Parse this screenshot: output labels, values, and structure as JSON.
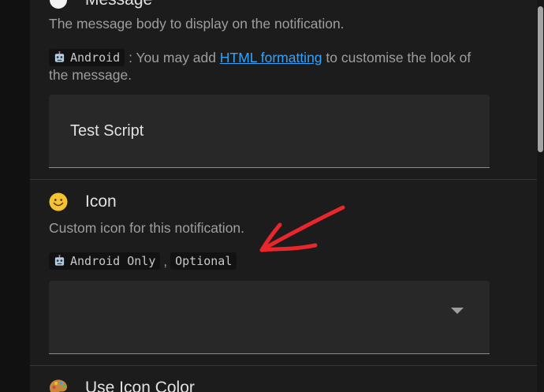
{
  "message_section": {
    "title": "Message",
    "description": "The message body to display on the notification.",
    "platform_tag": "Android",
    "note_before_link": " : You may add ",
    "link_text": "HTML formatting",
    "note_after_link": " to customise the look of the message.",
    "field_value": "Test Script"
  },
  "icon_section": {
    "emoji_icon": "smiling-face-icon",
    "title": "Icon",
    "description": "Custom icon for this notification.",
    "tag_android": "Android Only",
    "tag_separator": ",",
    "tag_optional": "Optional",
    "field_value": ""
  },
  "icon_color_section": {
    "emoji_icon": "palette-icon",
    "title": "Use Icon Color"
  },
  "annotation": {
    "arrow_icon": "red-hand-drawn-arrow-icon",
    "color": "#e8262b"
  },
  "colors": {
    "link": "#2fa4ff",
    "field_bg": "#282828",
    "panel_bg": "#1c1c1c"
  }
}
